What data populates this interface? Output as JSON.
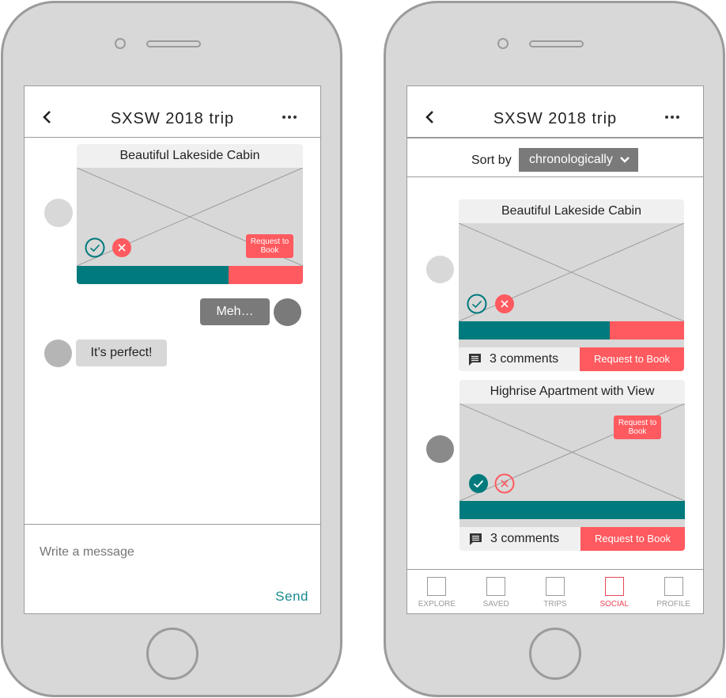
{
  "colors": {
    "teal": "#007a7c",
    "coral": "#ff5a5f",
    "active_tab": "#e8485a",
    "send": "#1a8a8f",
    "frame": "#d8d8d8",
    "outline": "#9b9b9b"
  },
  "left_phone": {
    "header": {
      "back_icon": "chevron-left",
      "title": "SXSW 2018 trip",
      "more_icon": "ellipsis"
    },
    "listing_card": {
      "title": "Beautiful Lakeside Cabin",
      "request_label": "Request to Book",
      "vote_yes_state": "outlined",
      "vote_no_state": "filled",
      "yes_fraction": 0.67
    },
    "messages": [
      {
        "sender": "self",
        "text": "Meh…"
      },
      {
        "sender": "other",
        "text": "It’s perfect!"
      }
    ],
    "composer": {
      "placeholder": "Write a message",
      "send_label": "Send"
    }
  },
  "right_phone": {
    "header": {
      "back_icon": "chevron-left",
      "title": "SXSW 2018 trip",
      "more_icon": "ellipsis"
    },
    "sort": {
      "label": "Sort by",
      "selected": "chronologically"
    },
    "listings": [
      {
        "title": "Beautiful Lakeside Cabin",
        "vote_yes_state": "outlined",
        "vote_no_state": "filled",
        "yes_fraction": 0.67,
        "comments": "3 comments",
        "request_label": "Request to Book"
      },
      {
        "title": "Highrise Apartment with View",
        "vote_yes_state": "filled",
        "vote_no_state": "outlined",
        "yes_fraction": 1.0,
        "comments": "3 comments",
        "request_label": "Request to Book",
        "image_request_label": "Request to Book"
      }
    ],
    "tabs": [
      {
        "label": "EXPLORE",
        "active": false
      },
      {
        "label": "SAVED",
        "active": false
      },
      {
        "label": "TRIPS",
        "active": false
      },
      {
        "label": "SOCIAL",
        "active": true
      },
      {
        "label": "PROFILE",
        "active": false
      }
    ]
  }
}
